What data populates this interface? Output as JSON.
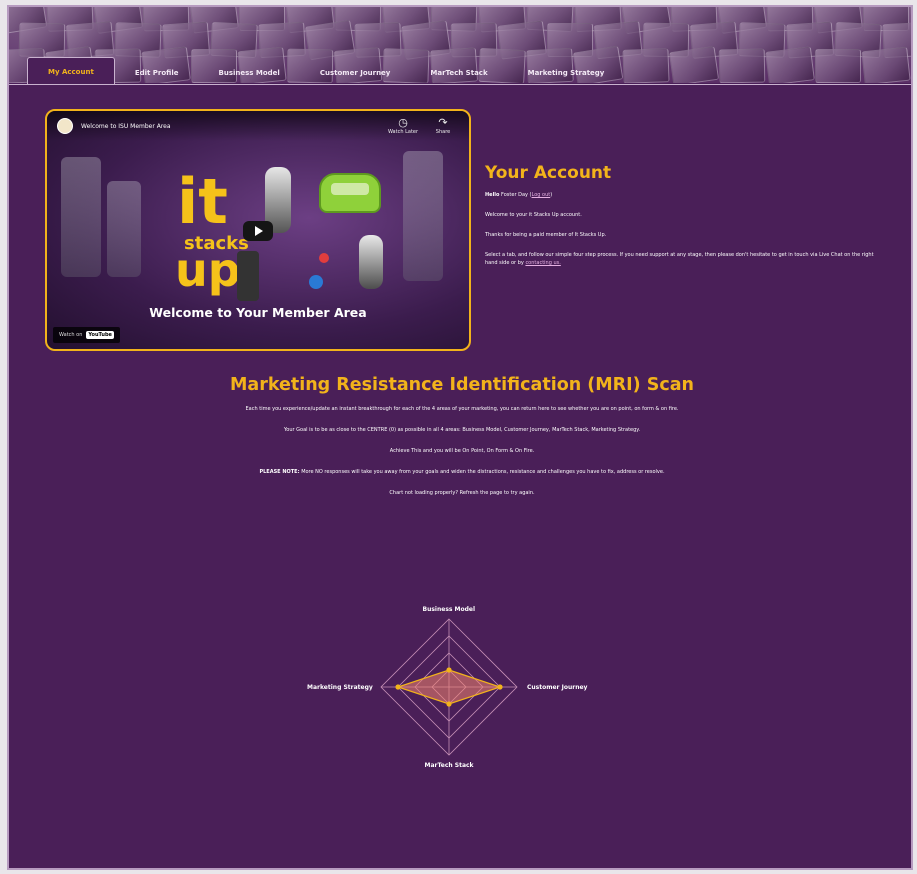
{
  "tabs": [
    {
      "label": "My Account",
      "active": true
    },
    {
      "label": "Edit Profile",
      "active": false
    },
    {
      "label": "Business Model",
      "active": false
    },
    {
      "label": "Customer Journey",
      "active": false
    },
    {
      "label": "MarTech Stack",
      "active": false
    },
    {
      "label": "Marketing Strategy",
      "active": false
    }
  ],
  "video": {
    "title": "Welcome to ISU Member Area",
    "watch_later": "Watch Later",
    "share": "Share",
    "brand_it": "it",
    "brand_stacks": "stacks",
    "brand_up": "up",
    "banner_text": "Welcome to Your Member Area",
    "watch_on": "Watch on",
    "youtube": "YouTube"
  },
  "account": {
    "heading": "Your Account",
    "hello_prefix": "Hello",
    "hello_name": "Foster Day",
    "logout_label": "Log out",
    "welcome_line": "Welcome to your it Stacks Up account.",
    "thanks_line": "Thanks for being a paid member of It Stacks Up.",
    "instructions": "Select a tab, and follow our simple four step process. If you need support at any stage, then please don't hesitate to get in touch via Live Chat on the right hand side or by",
    "contact_link": "contacting us."
  },
  "mri": {
    "title": "Marketing Resistance Identification (MRI) Scan",
    "para1": "Each time you experience/update an instant breakthrough for each of the 4 areas of your marketing, you can return here to see whether you are on point, on form & on fire.",
    "para2": "Your Goal is to be as close to the CENTRE (0) as possible in all 4 areas: Business Model, Customer Journey, MarTech Stack, Marketing Strategy.",
    "para3": "Achieve This and you will be On Point, On Form & On Fire.",
    "note_label": "PLEASE NOTE:",
    "note_text": "More NO responses will take you away from your goals and widen the distractions, resistance and challenges you have to fix, address or resolve.",
    "para5": "Chart not loading properly? Refresh the page to try again."
  },
  "chart_data": {
    "type": "radar",
    "axes": [
      "Business Model",
      "Customer Journey",
      "MarTech Stack",
      "Marketing Strategy"
    ],
    "rmax": 4,
    "rings": 4,
    "series": [
      {
        "values": [
          1,
          3,
          1,
          3
        ],
        "color": "#f2b31b"
      }
    ]
  },
  "colors": {
    "accent": "#f2b31b",
    "background": "#4a1f58"
  }
}
